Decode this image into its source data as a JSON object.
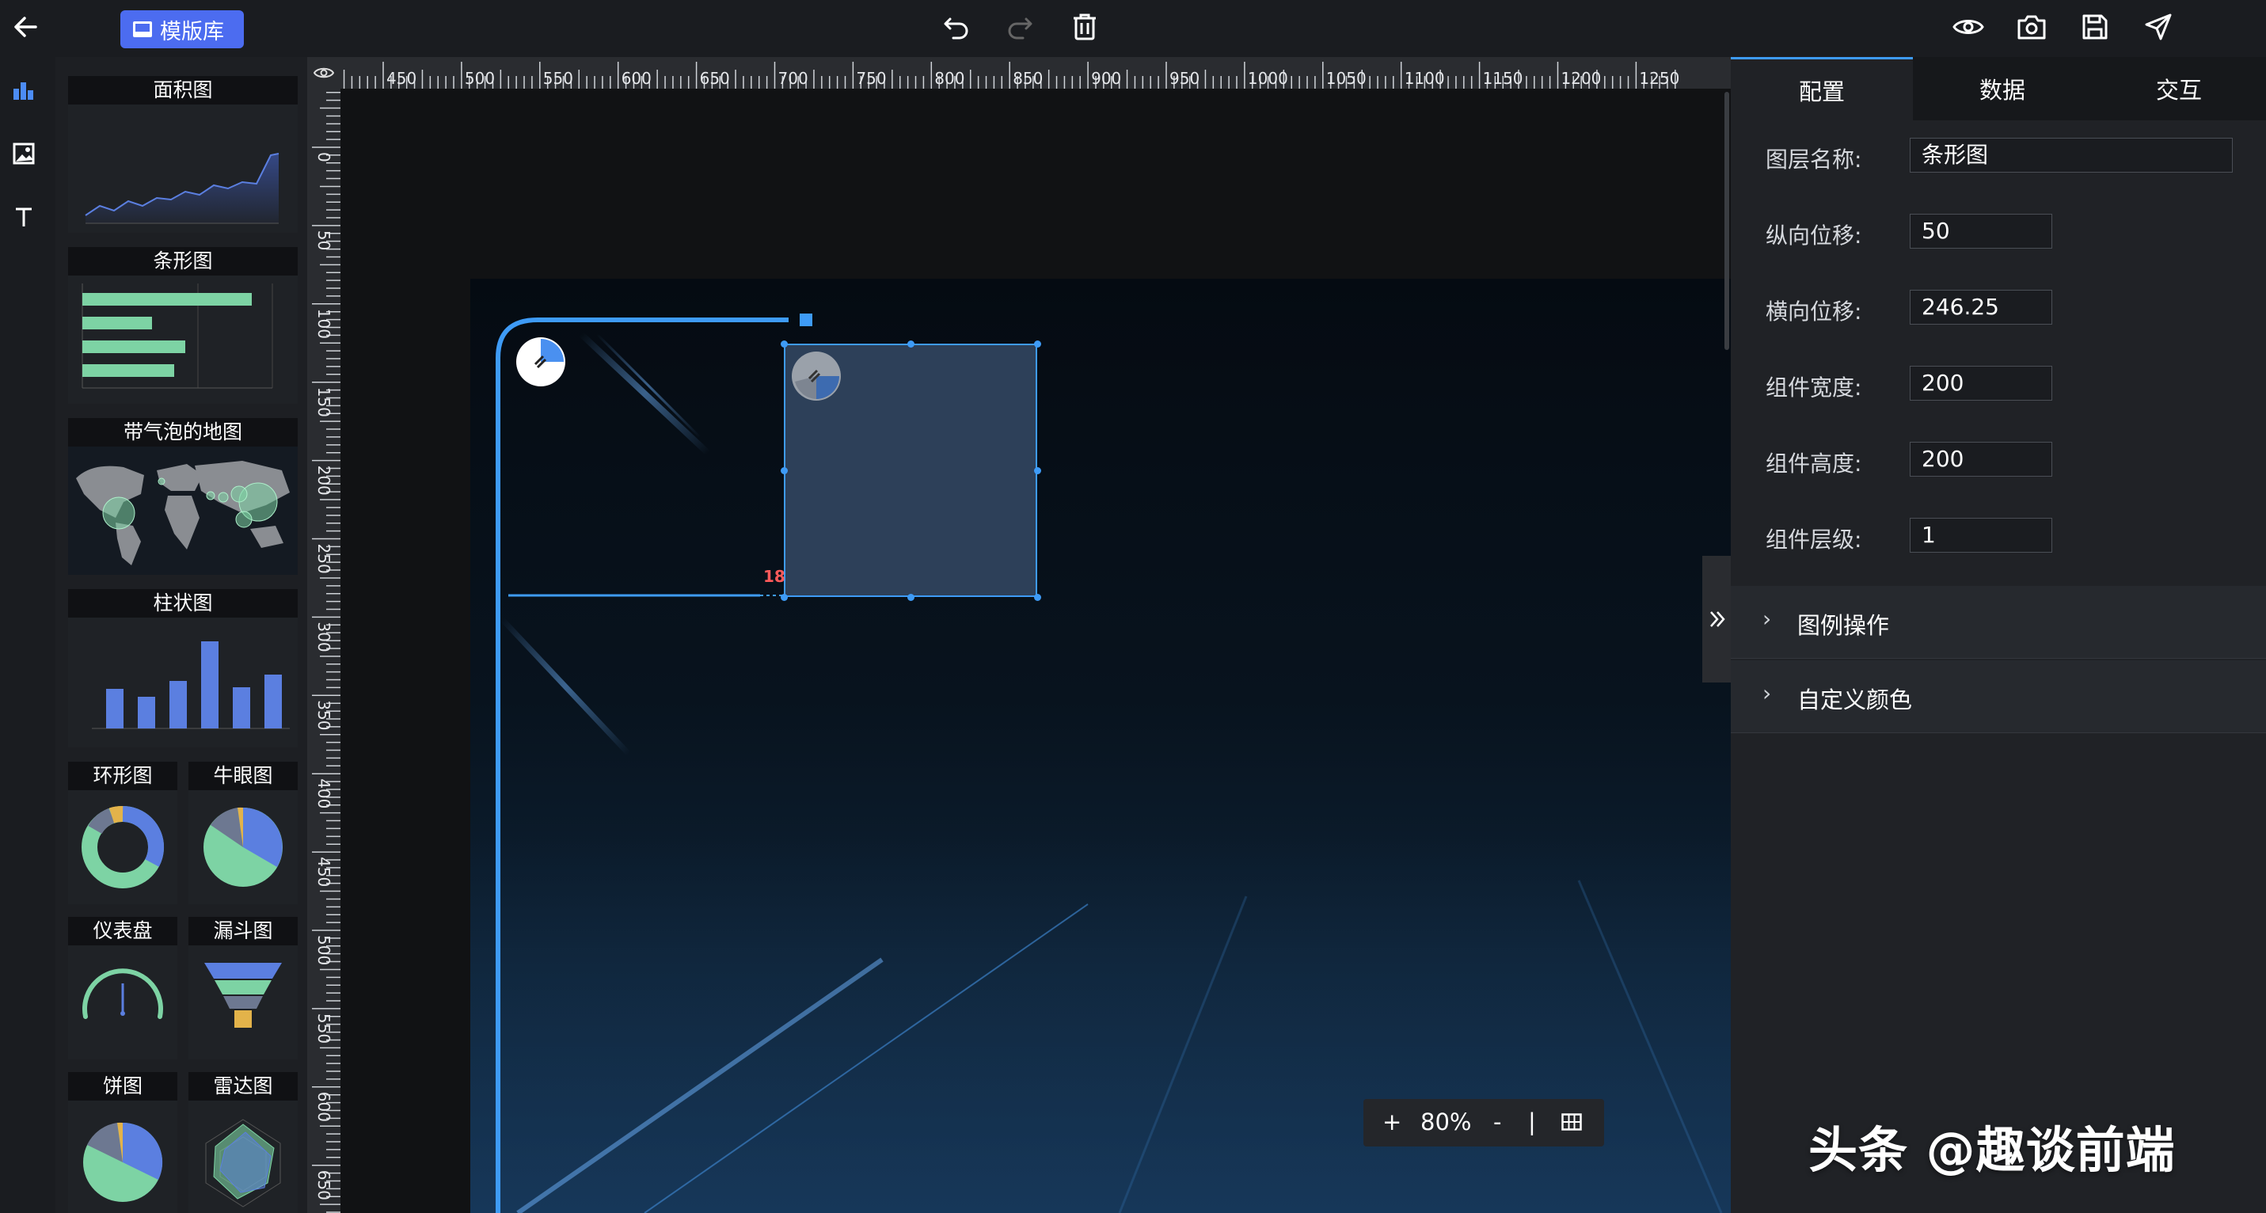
{
  "toolbar": {
    "template_button": "模版库"
  },
  "palette": {
    "items": [
      {
        "label": "面积图"
      },
      {
        "label": "条形图"
      },
      {
        "label": "带气泡的地图"
      },
      {
        "label": "柱状图"
      },
      {
        "label": "环形图"
      },
      {
        "label": "牛眼图"
      },
      {
        "label": "仪表盘"
      },
      {
        "label": "漏斗图"
      },
      {
        "label": "饼图"
      },
      {
        "label": "雷达图"
      }
    ]
  },
  "ruler": {
    "top_ticks": [
      "450",
      "500",
      "550",
      "600",
      "650",
      "700",
      "750",
      "800",
      "850",
      "900",
      "950",
      "1000",
      "1050",
      "1100",
      "1150",
      "1200",
      "1250"
    ],
    "left_ticks": [
      "0",
      "50",
      "100",
      "150",
      "200",
      "250",
      "300",
      "350",
      "400",
      "450",
      "500",
      "550",
      "600",
      "650"
    ]
  },
  "canvas": {
    "distance_label": "18"
  },
  "zoom": {
    "plus": "+",
    "value": "80%",
    "minus": "-",
    "separator": "|"
  },
  "panel": {
    "tabs": [
      "配置",
      "数据",
      "交互"
    ],
    "fields": [
      {
        "label": "图层名称:",
        "value": "条形图"
      },
      {
        "label": "纵向位移:",
        "value": "50"
      },
      {
        "label": "横向位移:",
        "value": "246.25"
      },
      {
        "label": "组件宽度:",
        "value": "200"
      },
      {
        "label": "组件高度:",
        "value": "200"
      },
      {
        "label": "组件层级:",
        "value": "1"
      }
    ],
    "sections": [
      "图例操作",
      "自定义颜色"
    ]
  },
  "watermark": "头条 @趣谈前端",
  "colors": {
    "accent": "#4c6cf0",
    "selection": "#3e9bf6",
    "chart_green": "#7dd3a4",
    "chart_blue": "#5b7fe0"
  }
}
